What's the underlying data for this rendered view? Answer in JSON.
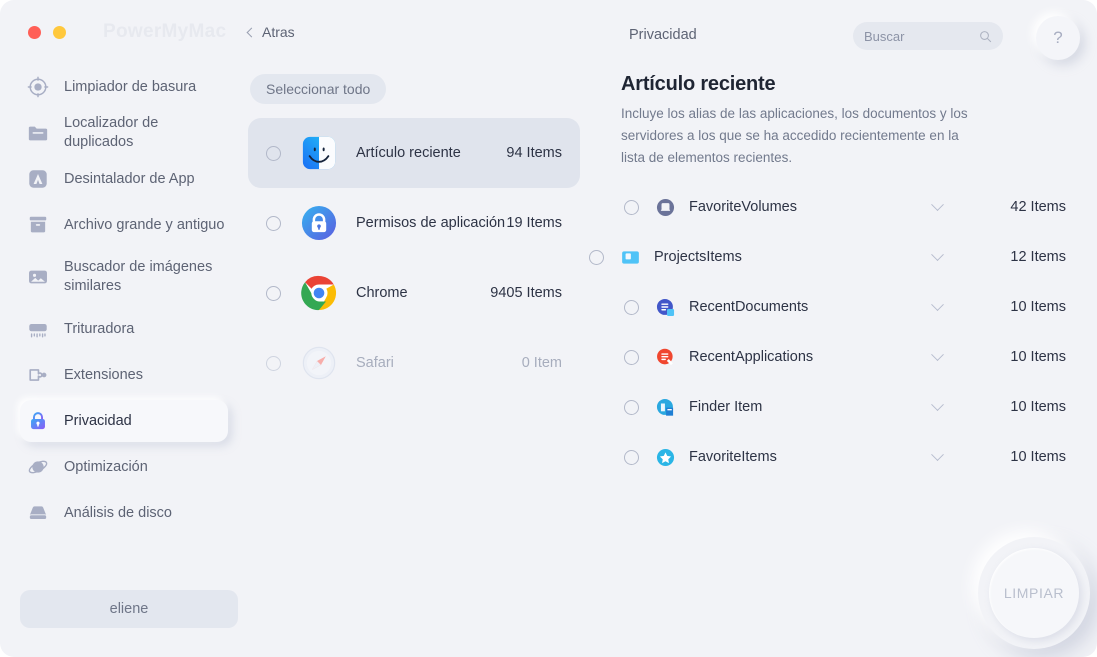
{
  "window": {
    "app_title": "PowerMyMac",
    "traffic_lights": [
      {
        "name": "close",
        "color": "#ff5f57"
      },
      {
        "name": "minimize",
        "color": "#ffc83d"
      }
    ],
    "back_label": "Atras"
  },
  "header": {
    "section_title": "Privacidad",
    "search_placeholder": "Buscar",
    "help_label": "?"
  },
  "sidebar": {
    "items": [
      {
        "label": "Limpiador de basura",
        "icon": "target-icon",
        "active": false
      },
      {
        "label": "Localizador de duplicados",
        "icon": "folder-icon",
        "active": false
      },
      {
        "label": "Desintalador de App",
        "icon": "appstore-icon",
        "active": false
      },
      {
        "label": "Archivo grande y antiguo",
        "icon": "box-icon",
        "active": false
      },
      {
        "label": "Buscador de imágenes similares",
        "icon": "image-icon",
        "active": false
      },
      {
        "label": "Trituradora",
        "icon": "shredder-icon",
        "active": false
      },
      {
        "label": "Extensiones",
        "icon": "extension-icon",
        "active": false
      },
      {
        "label": "Privacidad",
        "icon": "lock-icon",
        "active": true
      },
      {
        "label": "Optimización",
        "icon": "optimize-icon",
        "active": false
      },
      {
        "label": "Análisis de disco",
        "icon": "disk-icon",
        "active": false
      }
    ],
    "bottom_button": "eliene"
  },
  "middle": {
    "select_all_label": "Seleccionar todo",
    "rows": [
      {
        "name": "Artículo reciente",
        "count": "94 Items",
        "icon": "finder-icon",
        "selected": true,
        "disabled": false
      },
      {
        "name": "Permisos de aplicación",
        "count": "19 Items",
        "icon": "app-permissions-icon",
        "selected": false,
        "disabled": false
      },
      {
        "name": "Chrome",
        "count": "9405 Items",
        "icon": "chrome-icon",
        "selected": false,
        "disabled": false
      },
      {
        "name": "Safari",
        "count": "0 Item",
        "icon": "safari-icon",
        "selected": false,
        "disabled": true
      }
    ]
  },
  "detail": {
    "title": "Artículo reciente",
    "description": "Incluye los alias de las aplicaciones, los documentos y los servidores a los que se ha accedido recientemente en la lista de elementos recientes.",
    "rows": [
      {
        "name": "FavoriteVolumes",
        "count": "42 Items",
        "icon": "volume-icon"
      },
      {
        "name": "ProjectsItems",
        "count": "12 Items",
        "icon": "projects-icon"
      },
      {
        "name": "RecentDocuments",
        "count": "10 Items",
        "icon": "documents-icon"
      },
      {
        "name": "RecentApplications",
        "count": "10 Items",
        "icon": "applications-icon"
      },
      {
        "name": "Finder Item",
        "count": "10 Items",
        "icon": "finder-item-icon"
      },
      {
        "name": "FavoriteItems",
        "count": "10 Items",
        "icon": "favorites-icon"
      }
    ]
  },
  "action": {
    "clean_label": "LIMPIAR"
  },
  "colors": {
    "background": "#f2f3f7",
    "selected_row": "#e0e4ed",
    "pill": "#e3e7ef",
    "text_primary": "#2d3345",
    "text_secondary": "#727a8d",
    "accent_blue": "#3b82f6",
    "accent_purple": "#8b5cf6"
  }
}
